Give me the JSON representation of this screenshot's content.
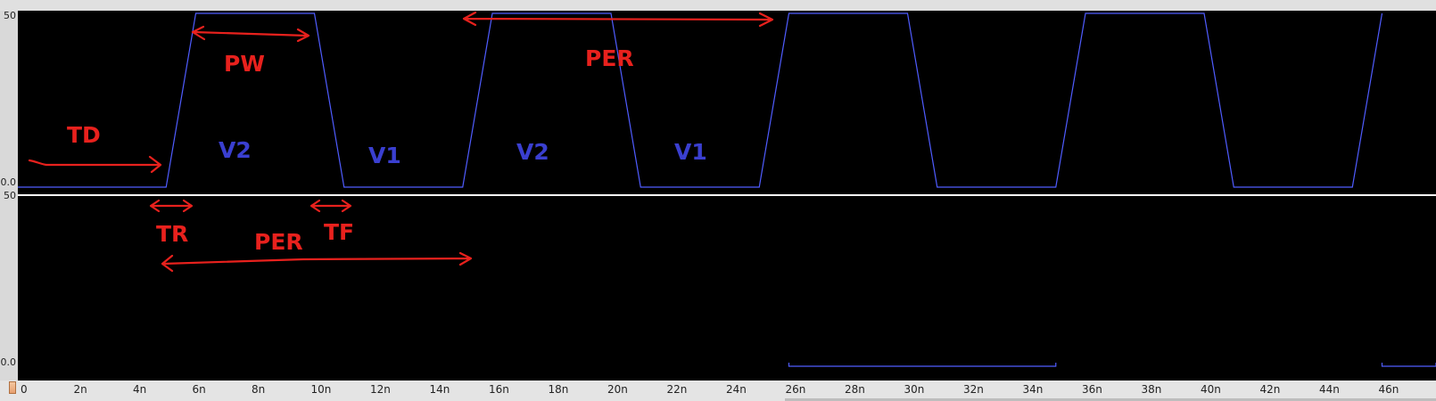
{
  "y_axis": {
    "top_max": "50",
    "top_min": "0.0",
    "bottom_max": "50",
    "bottom_min": "0.0"
  },
  "x_axis": {
    "unit_suffix": "n",
    "ticks": [
      "0",
      "2n",
      "4n",
      "6n",
      "8n",
      "10n",
      "12n",
      "14n",
      "16n",
      "18n",
      "20n",
      "22n",
      "24n",
      "26n",
      "28n",
      "30n",
      "32n",
      "34n",
      "36n",
      "38n",
      "40n",
      "42n",
      "44n",
      "46n"
    ],
    "range_ns": [
      0,
      48
    ]
  },
  "pulse": {
    "td_ns": 5,
    "tr_ns": 1,
    "pw_ns": 5,
    "tf_ns": 1,
    "per_ns": 10,
    "v1": 0,
    "v2": 50,
    "cycles": 5,
    "color": "#4f5cff"
  },
  "bottom_trace": {
    "segments_ns": [
      [
        26,
        35
      ],
      [
        46,
        48
      ]
    ],
    "color": "#4f5cff"
  },
  "annotations": {
    "td": "TD",
    "pw": "PW",
    "per_top": "PER",
    "v2_first": "V2",
    "v1_first": "V1",
    "v2_second": "V2",
    "v1_second": "V1",
    "tr": "TR",
    "per_bottom": "PER",
    "tf": "TF",
    "red_color": "#e8211d",
    "blue_color": "#3a3fd0"
  }
}
